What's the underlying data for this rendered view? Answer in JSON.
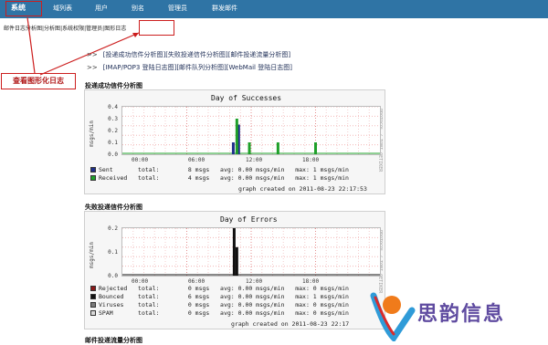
{
  "topnav": {
    "items": [
      "系统",
      "域列表",
      "用户",
      "别名",
      "管理员",
      "群发邮件"
    ]
  },
  "subnav": {
    "items": [
      "邮件日志分析图",
      "分析图",
      "系统权限",
      "管理员",
      "图形日志"
    ]
  },
  "links": {
    "row1": [
      "[投递成功信件分析图]",
      "[失败投递信件分析图]",
      "[邮件投递流量分析图]"
    ],
    "row2": [
      "[IMAP/POP3 登陆日志图]",
      "[邮件队列分析图]",
      "[WebMail 登陆日志图]"
    ]
  },
  "callout": {
    "label": "查看图形化日志"
  },
  "brand": {
    "name": "思韵信息"
  },
  "sections": {
    "success_title": "投递成功信件分析图",
    "errors_title": "失败投递信件分析图",
    "third_title": "邮件投递流量分析图"
  },
  "chart_data": [
    {
      "type": "bar",
      "title": "Day of Successes",
      "ylabel": "msgs/min",
      "xlabel": "",
      "ylim": [
        0,
        0.4
      ],
      "y_ticks": [
        "0.4",
        "0.3",
        "0.2",
        "0.1",
        "0.0"
      ],
      "x_ticks": [
        "00:00",
        "06:00",
        "12:00",
        "18:00"
      ],
      "series": [
        {
          "name": "Sent",
          "color": "#1f2f8a",
          "points": [
            {
              "x": "10:20",
              "y": 0.1
            },
            {
              "x": "10:50",
              "y": 0.25
            }
          ]
        },
        {
          "name": "Received",
          "color": "#1fa02a",
          "points": [
            {
              "x": "10:40",
              "y": 0.3
            },
            {
              "x": "11:50",
              "y": 0.1
            },
            {
              "x": "14:30",
              "y": 0.1
            },
            {
              "x": "18:00",
              "y": 0.1
            }
          ]
        }
      ],
      "legend": [
        {
          "name": "Sent",
          "text": "Sent       total:        8 msgs   avg: 0.00 msgs/min   max: 1 msgs/min",
          "color": "#1f2f8a"
        },
        {
          "name": "Received",
          "text": "Received   total:        4 msgs   avg: 0.00 msgs/min   max: 1 msgs/min",
          "color": "#1fa02a"
        }
      ],
      "created": "graph created on 2011-08-23 22:17:53",
      "sidetag": "PROTOCOL / TOBI OETIKER",
      "grid": true
    },
    {
      "type": "bar",
      "title": "Day of Errors",
      "ylabel": "msgs/min",
      "xlabel": "",
      "ylim": [
        0,
        0.25
      ],
      "y_ticks": [
        "0.2",
        "0.1",
        "0.0"
      ],
      "x_ticks": [
        "00:00",
        "06:00",
        "12:00",
        "18:00"
      ],
      "series": [
        {
          "name": "Bounced",
          "color": "#111111",
          "points": [
            {
              "x": "10:25",
              "y": 0.25
            },
            {
              "x": "10:40",
              "y": 0.15
            }
          ]
        }
      ],
      "legend": [
        {
          "name": "Rejected",
          "text": "Rejected   total:        0 msgs   avg: 0.00 msgs/min   max: 0 msgs/min",
          "color": "#8b1a1a"
        },
        {
          "name": "Bounced",
          "text": "Bounced    total:        6 msgs   avg: 0.00 msgs/min   max: 1 msgs/min",
          "color": "#111111"
        },
        {
          "name": "Viruses",
          "text": "Viruses    total:        0 msgs   avg: 0.00 msgs/min   max: 0 msgs/min",
          "color": "#7a7a7a"
        },
        {
          "name": "SPAM",
          "text": "SPAM       total:        0 msgs   avg: 0.00 msgs/min   max: 0 msgs/min",
          "color": "#d8d8d8"
        }
      ],
      "created": "graph created on 2011-08-23 22:17",
      "sidetag": "PROTOCOL / TOBI OETIKER",
      "grid": true
    }
  ],
  "colors": {
    "topnav_bg": "#2f74a5",
    "highlight": "#cc1e1e",
    "brand_purple": "#5f4ba0",
    "brand_orange": "#f07b1b",
    "brand_blue": "#2f9bd8"
  }
}
